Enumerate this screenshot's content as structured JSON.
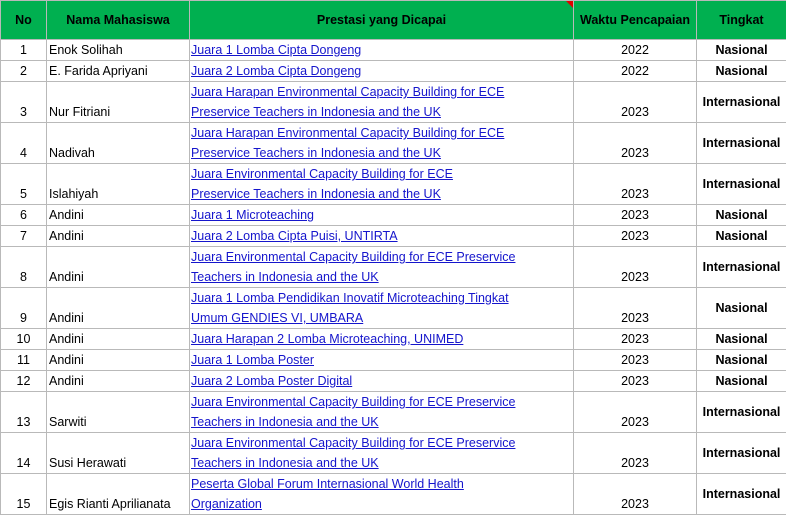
{
  "headers": {
    "no": "No",
    "name": "Nama Mahasiswa",
    "achievement": "Prestasi yang Dicapai",
    "time": "Waktu Pencapaian",
    "level": "Tingkat"
  },
  "rows": [
    {
      "no": "1",
      "name": "Enok Solihah",
      "achievement": [
        "Juara 1 Lomba Cipta Dongeng"
      ],
      "year": "2022",
      "level": "Nasional"
    },
    {
      "no": "2",
      "name": "E. Farida Apriyani",
      "achievement": [
        "Juara 2 Lomba Cipta Dongeng"
      ],
      "year": "2022",
      "level": "Nasional"
    },
    {
      "no": "3",
      "name": "Nur Fitriani",
      "achievement": [
        "Juara Harapan Environmental Capacity Building for ECE",
        " Preservice Teachers in Indonesia and the UK"
      ],
      "year": "2023",
      "level": "Internasional"
    },
    {
      "no": "4",
      "name": "Nadivah",
      "achievement": [
        "Juara Harapan Environmental Capacity Building for ECE",
        " Preservice Teachers in Indonesia and the UK"
      ],
      "year": "2023",
      "level": "Internasional"
    },
    {
      "no": "5",
      "name": "Islahiyah",
      "achievement": [
        "Juara Environmental Capacity Building for ECE",
        " Preservice Teachers in Indonesia and the UK"
      ],
      "year": "2023",
      "level": "Internasional"
    },
    {
      "no": "6",
      "name": "Andini",
      "achievement": [
        "Juara 1 Microteaching"
      ],
      "year": "2023",
      "level": "Nasional"
    },
    {
      "no": "7",
      "name": "Andini",
      "achievement": [
        "Juara 2 Lomba Cipta Puisi, UNTIRTA"
      ],
      "year": "2023",
      "level": "Nasional"
    },
    {
      "no": "8",
      "name": "Andini",
      "achievement": [
        "Juara Environmental Capacity Building for ECE Preservice",
        "Teachers in Indonesia and the UK"
      ],
      "year": "2023",
      "level": "Internasional"
    },
    {
      "no": "9",
      "name": "Andini",
      "achievement": [
        "Juara 1 Lomba Pendidikan Inovatif Microteaching Tingkat",
        "Umum GENDIES VI, UMBARA"
      ],
      "year": "2023",
      "level": "Nasional"
    },
    {
      "no": "10",
      "name": "Andini",
      "achievement": [
        "Juara Harapan 2 Lomba Microteaching, UNIMED"
      ],
      "year": "2023",
      "level": "Nasional"
    },
    {
      "no": "11",
      "name": "Andini",
      "achievement": [
        "Juara 1 Lomba Poster"
      ],
      "year": "2023",
      "level": "Nasional"
    },
    {
      "no": "12",
      "name": "Andini",
      "achievement": [
        "Juara 2 Lomba Poster Digital"
      ],
      "year": "2023",
      "level": "Nasional"
    },
    {
      "no": "13",
      "name": "Sarwiti",
      "achievement": [
        "Juara Environmental Capacity Building for ECE Preservice",
        "Teachers in Indonesia and the UK"
      ],
      "year": "2023",
      "level": "Internasional"
    },
    {
      "no": "14",
      "name": "Susi Herawati",
      "achievement": [
        "Juara Environmental Capacity Building for ECE Preservice",
        "Teachers in Indonesia and the UK"
      ],
      "year": "2023",
      "level": "Internasional"
    },
    {
      "no": "15",
      "name": "Egis Rianti Aprilianata",
      "achievement": [
        "Peserta Global Forum Internasional World Health",
        "Organization"
      ],
      "year": "2023",
      "level": "Internasional"
    }
  ],
  "colors": {
    "header_bg": "#00b050",
    "link": "#1515cc",
    "comment_marker": "#e00000",
    "grid": "#b9b9b9"
  }
}
